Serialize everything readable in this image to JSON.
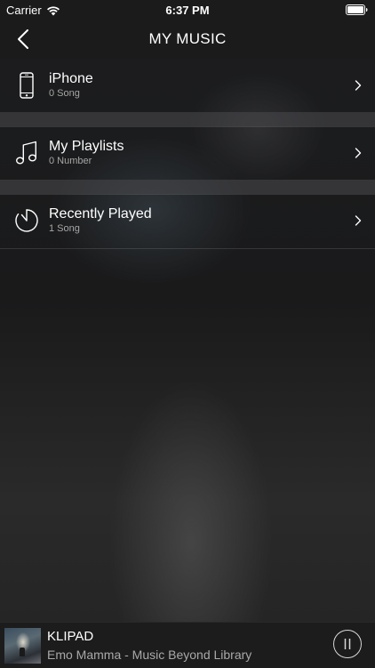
{
  "status_bar": {
    "carrier": "Carrier",
    "time": "6:37 PM",
    "wifi_icon": "wifi-icon",
    "battery_icon": "battery-icon"
  },
  "nav": {
    "title": "MY MUSIC",
    "back_icon": "chevron-left-icon"
  },
  "rows": [
    {
      "title": "iPhone",
      "subtitle": "0 Song",
      "icon": "iphone-icon"
    },
    {
      "title": "My Playlists",
      "subtitle": "0 Number",
      "icon": "music-note-icon"
    },
    {
      "title": "Recently Played",
      "subtitle": "1 Song",
      "icon": "clock-icon"
    }
  ],
  "now_playing": {
    "title": "KLIPAD",
    "subtitle": "Emo Mamma - Music Beyond Library",
    "control_icon": "pause-icon"
  },
  "colors": {
    "bar_background": "#1b1b1b",
    "text_primary": "#ffffff",
    "text_secondary": "#a6a6a6"
  }
}
